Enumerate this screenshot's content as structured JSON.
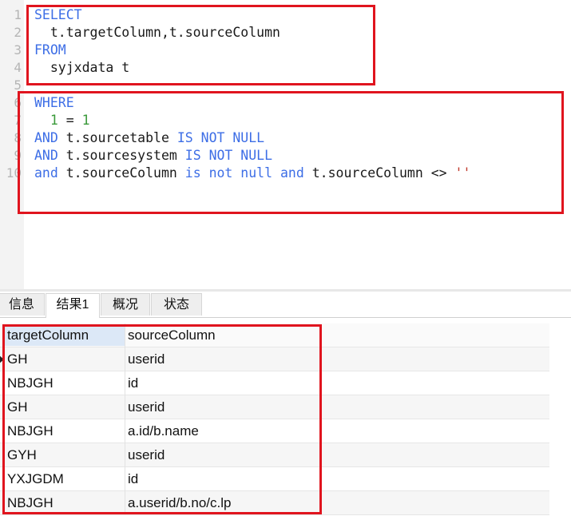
{
  "editor": {
    "line_numbers": [
      "1",
      "2",
      "3",
      "4",
      "5",
      "6",
      "7",
      "8",
      "9",
      "10"
    ],
    "lines": [
      [
        {
          "t": "SELECT",
          "c": "kw"
        }
      ],
      [
        {
          "t": "  t.targetColumn,t.sourceColumn",
          "c": ""
        }
      ],
      [
        {
          "t": "FROM",
          "c": "kw"
        }
      ],
      [
        {
          "t": "  syjxdata t",
          "c": ""
        }
      ],
      [],
      [
        {
          "t": "WHERE",
          "c": "kw"
        }
      ],
      [
        {
          "t": "  ",
          "c": ""
        },
        {
          "t": "1",
          "c": "num"
        },
        {
          "t": " = ",
          "c": ""
        },
        {
          "t": "1",
          "c": "num"
        }
      ],
      [
        {
          "t": "AND",
          "c": "kw"
        },
        {
          "t": " t.sourcetable ",
          "c": ""
        },
        {
          "t": "IS NOT NULL",
          "c": "kw"
        }
      ],
      [
        {
          "t": "AND",
          "c": "kw"
        },
        {
          "t": " t.sourcesystem ",
          "c": ""
        },
        {
          "t": "IS NOT NULL",
          "c": "kw"
        }
      ],
      [
        {
          "t": "and",
          "c": "kw"
        },
        {
          "t": " t.sourceColumn ",
          "c": ""
        },
        {
          "t": "is not null",
          "c": "kw"
        },
        {
          "t": " ",
          "c": ""
        },
        {
          "t": "and",
          "c": "kw"
        },
        {
          "t": " t.sourceColumn <> ",
          "c": ""
        },
        {
          "t": "''",
          "c": "str"
        }
      ]
    ]
  },
  "tabs": [
    {
      "label": "信息",
      "active": false
    },
    {
      "label": "结果1",
      "active": true
    },
    {
      "label": "概况",
      "active": false
    },
    {
      "label": "状态",
      "active": false
    }
  ],
  "grid": {
    "columns": [
      "targetColumn",
      "sourceColumn"
    ],
    "rows": [
      [
        "GH",
        "userid"
      ],
      [
        "NBJGH",
        "id"
      ],
      [
        "GH",
        "userid"
      ],
      [
        "NBJGH",
        "a.id/b.name"
      ],
      [
        "GYH",
        "userid"
      ],
      [
        "YXJGDM",
        "id"
      ],
      [
        "NBJGH",
        "a.userid/b.no/c.lp"
      ]
    ],
    "current_row": 0
  },
  "colors": {
    "keyword": "#3d6ee6",
    "number": "#3a9a3a",
    "string": "#c0392b",
    "highlight": "#e0141e"
  }
}
